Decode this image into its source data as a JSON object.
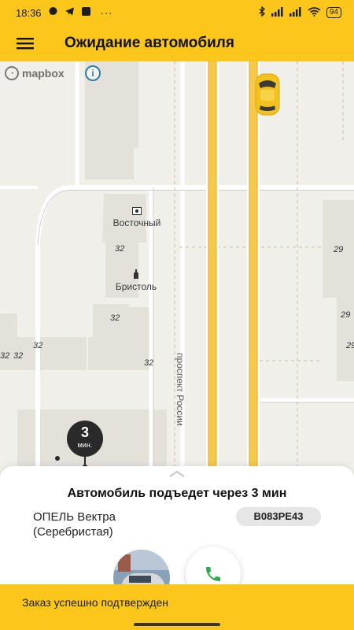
{
  "status_bar": {
    "time": "18:36",
    "battery": "94"
  },
  "app_bar": {
    "title": "Ожидание автомобиля"
  },
  "map": {
    "attribution": "mapbox",
    "poi": [
      {
        "label": "Восточный",
        "icon": "store-icon"
      },
      {
        "label": "Бристоль",
        "icon": "bottle-icon"
      }
    ],
    "house_numbers": [
      "32",
      "32",
      "32",
      "32",
      "32",
      "32",
      "29",
      "29",
      "29"
    ],
    "street_name": "проспект России",
    "eta": {
      "value": "3",
      "unit": "мин."
    }
  },
  "ride": {
    "arrival_text": "Автомобиль подъедет через 3 мин",
    "car_model_line1": "ОПЕЛЬ Вектра",
    "car_model_line2": "(Серебристая)",
    "plate": "В083РЕ43"
  },
  "snackbar": {
    "message": "Заказ успешно подтвержден"
  },
  "colors": {
    "accent": "#fcc71a",
    "call": "#2fa84f"
  }
}
